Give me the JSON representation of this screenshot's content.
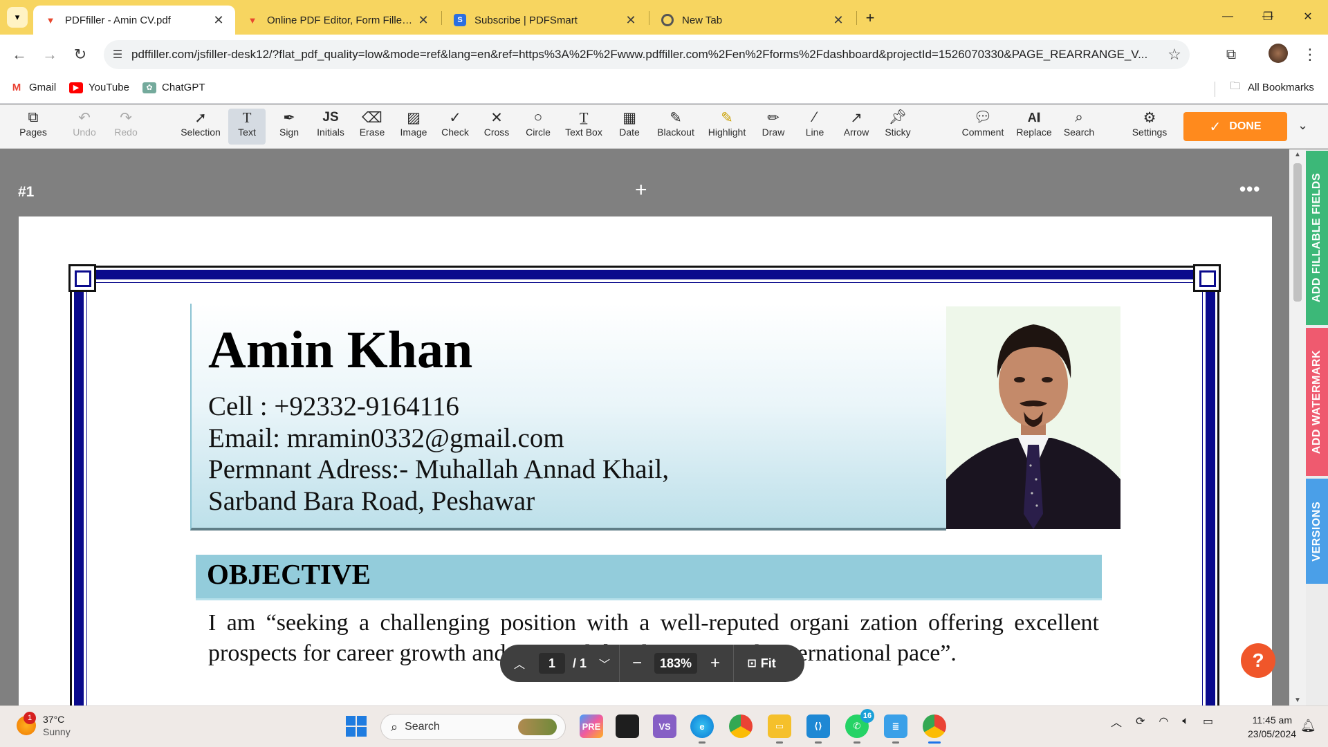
{
  "browser": {
    "tabs": [
      {
        "title": "PDFfiller - Amin CV.pdf",
        "icon": "pdffiller-icon",
        "active": true
      },
      {
        "title": "Online PDF Editor, Form Filler, and",
        "icon": "pdffiller-icon",
        "active": false
      },
      {
        "title": "Subscribe | PDFSmart",
        "icon": "pdfsmart-icon",
        "active": false
      },
      {
        "title": "New Tab",
        "icon": "chrome-icon",
        "active": false
      }
    ],
    "url": "pdffiller.com/jsfiller-desk12/?flat_pdf_quality=low&mode=ref&lang=en&ref=https%3A%2F%2Fwww.pdffiller.com%2Fen%2Fforms%2Fdashboard&projectId=1526070330&PAGE_REARRANGE_V...",
    "bookmarks": [
      {
        "label": "Gmail",
        "icon": "gmail-icon"
      },
      {
        "label": "YouTube",
        "icon": "youtube-icon"
      },
      {
        "label": "ChatGPT",
        "icon": "chatgpt-icon"
      }
    ],
    "all_bookmarks": "All Bookmarks"
  },
  "toolbar": {
    "pages": "Pages",
    "undo": "Undo",
    "redo": "Redo",
    "tools": [
      "Selection",
      "Text",
      "Sign",
      "Initials",
      "Erase",
      "Image",
      "Check",
      "Cross",
      "Circle",
      "Text Box",
      "Date",
      "Blackout",
      "Highlight",
      "Draw",
      "Line",
      "Arrow",
      "Sticky"
    ],
    "right_tools": [
      "Comment",
      "Replace",
      "Search"
    ],
    "settings": "Settings",
    "done": "DONE",
    "active_tool": "Text"
  },
  "workspace": {
    "page_label": "#1",
    "add_page": "+",
    "more": "•••"
  },
  "document": {
    "name": "Amin Khan",
    "cell": "Cell : +92332-9164116",
    "email": "Email: mramin0332@gmail.com",
    "address_line1": "Permnant Adress:- Muhallah Annad Khail,",
    "address_line2": "Sarband Bara Road, Peshawar",
    "objective_title": "OBJECTIVE",
    "objective_text": "I am “seeking a challenging position with a well-reputed organi zation offering excellent prospects for career growth and personal development with international pace”."
  },
  "zoom": {
    "current_page": "1",
    "total_pages": "/ 1",
    "zoom_level": "183%",
    "fit": "Fit"
  },
  "side_tabs": [
    {
      "label": "ADD FILLABLE FIELDS",
      "color": "#3cb878"
    },
    {
      "label": "ADD WATERMARK",
      "color": "#ef5a6f"
    },
    {
      "label": "VERSIONS",
      "color": "#4a9fe8"
    }
  ],
  "taskbar": {
    "weather_temp": "37°C",
    "weather_desc": "Sunny",
    "weather_badge": "1",
    "search_placeholder": "Search",
    "whatsapp_badge": "16",
    "time": "11:45 am",
    "date": "23/05/2024"
  }
}
